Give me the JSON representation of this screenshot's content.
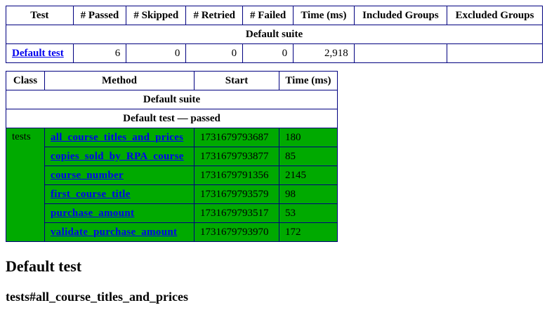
{
  "summary": {
    "headers": [
      "Test",
      "# Passed",
      "# Skipped",
      "# Retried",
      "# Failed",
      "Time (ms)",
      "Included Groups",
      "Excluded Groups"
    ],
    "suite_name": "Default suite",
    "row": {
      "test": "Default test",
      "passed": "6",
      "skipped": "0",
      "retried": "0",
      "failed": "0",
      "time": "2,918",
      "included": "",
      "excluded": ""
    }
  },
  "methods": {
    "headers": [
      "Class",
      "Method",
      "Start",
      "Time (ms)"
    ],
    "suite_name": "Default suite",
    "test_banner": "Default test — passed",
    "class_name": "tests",
    "rows": [
      {
        "method": "all_course_titles_and_prices",
        "start": "1731679793687",
        "time": "180"
      },
      {
        "method": "copies_sold_by_RPA_course",
        "start": "1731679793877",
        "time": "85"
      },
      {
        "method": "course_number",
        "start": "1731679791356",
        "time": "2145"
      },
      {
        "method": "first_course_title",
        "start": "1731679793579",
        "time": "98"
      },
      {
        "method": "purchase_amount",
        "start": "1731679793517",
        "time": "53"
      },
      {
        "method": "validate_purchase_amount",
        "start": "1731679793970",
        "time": "172"
      }
    ]
  },
  "section_title": "Default test",
  "method_title": "tests#all_course_titles_and_prices",
  "colors": {
    "pass": "#00aa00",
    "border": "#000080",
    "link": "#0000ee"
  }
}
